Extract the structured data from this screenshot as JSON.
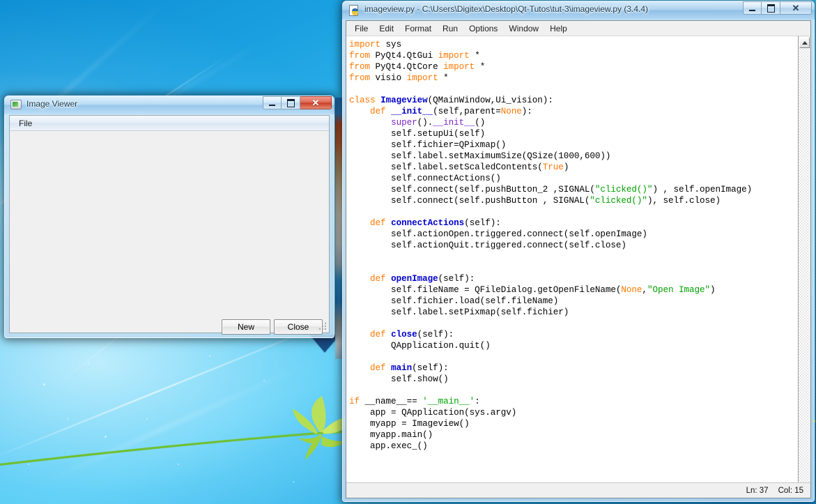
{
  "desktop": {
    "name": "windows-7-harmony-wallpaper"
  },
  "image_viewer": {
    "title": "Image Viewer",
    "icon": "app-monitor-icon",
    "menu": [
      "File"
    ],
    "buttons": {
      "new": "New",
      "close": "Close"
    },
    "window_controls": {
      "minimize": "minimize-icon",
      "maximize": "maximize-icon",
      "close": "✕"
    },
    "accent_close": "#cc3f28"
  },
  "idle": {
    "title": "imageview.py - C:\\Users\\Digitex\\Desktop\\Qt-Tutos\\tut-3\\imageview.py (3.4.4)",
    "icon": "python-file-icon",
    "menu": [
      "File",
      "Edit",
      "Format",
      "Run",
      "Options",
      "Window",
      "Help"
    ],
    "window_controls": {
      "minimize": "minimize-icon",
      "maximize": "maximize-icon",
      "close": "✕"
    },
    "status": {
      "line_label": "Ln: 37",
      "col_label": "Col: 15"
    },
    "colors": {
      "keyword": "#ff7700",
      "definition": "#0000cc",
      "builtin": "#7a27c4",
      "string": "#00a000",
      "text": "#000000",
      "background": "#ffffff"
    },
    "code_lines": [
      [
        [
          "k",
          "import"
        ],
        [
          "t",
          " sys"
        ]
      ],
      [
        [
          "k",
          "from"
        ],
        [
          "t",
          " PyQt4.QtGui "
        ],
        [
          "k",
          "import"
        ],
        [
          "t",
          " *"
        ]
      ],
      [
        [
          "k",
          "from"
        ],
        [
          "t",
          " PyQt4.QtCore "
        ],
        [
          "k",
          "import"
        ],
        [
          "t",
          " *"
        ]
      ],
      [
        [
          "k",
          "from"
        ],
        [
          "t",
          " visio "
        ],
        [
          "k",
          "import"
        ],
        [
          "t",
          " *"
        ]
      ],
      [],
      [
        [
          "k",
          "class"
        ],
        [
          "t",
          " "
        ],
        [
          "d",
          "Imageview"
        ],
        [
          "t",
          "(QMainWindow,Ui_vision):"
        ]
      ],
      [
        [
          "t",
          "    "
        ],
        [
          "k",
          "def"
        ],
        [
          "t",
          " "
        ],
        [
          "d",
          "__init__"
        ],
        [
          "t",
          "(self,parent="
        ],
        [
          "k",
          "None"
        ],
        [
          "t",
          "):"
        ]
      ],
      [
        [
          "t",
          "        "
        ],
        [
          "b",
          "super"
        ],
        [
          "t",
          "()."
        ],
        [
          "b",
          "__init__"
        ],
        [
          "t",
          "()"
        ]
      ],
      [
        [
          "t",
          "        self.setupUi(self)"
        ]
      ],
      [
        [
          "t",
          "        self.fichier=QPixmap()"
        ]
      ],
      [
        [
          "t",
          "        self.label.setMaximumSize(QSize(1000,600))"
        ]
      ],
      [
        [
          "t",
          "        self.label.setScaledContents("
        ],
        [
          "k",
          "True"
        ],
        [
          "t",
          ")"
        ]
      ],
      [
        [
          "t",
          "        self.connectActions()"
        ]
      ],
      [
        [
          "t",
          "        self.connect(self.pushButton_2 ,SIGNAL("
        ],
        [
          "s",
          "\"clicked()\""
        ],
        [
          "t",
          ") , self.openImage)"
        ]
      ],
      [
        [
          "t",
          "        self.connect(self.pushButton , SIGNAL("
        ],
        [
          "s",
          "\"clicked()\""
        ],
        [
          "t",
          "), self.close)"
        ]
      ],
      [],
      [
        [
          "t",
          "    "
        ],
        [
          "k",
          "def"
        ],
        [
          "t",
          " "
        ],
        [
          "d",
          "connectActions"
        ],
        [
          "t",
          "(self):"
        ]
      ],
      [
        [
          "t",
          "        self.actionOpen.triggered.connect(self.openImage)"
        ]
      ],
      [
        [
          "t",
          "        self.actionQuit.triggered.connect(self.close)"
        ]
      ],
      [],
      [],
      [
        [
          "t",
          "    "
        ],
        [
          "k",
          "def"
        ],
        [
          "t",
          " "
        ],
        [
          "d",
          "openImage"
        ],
        [
          "t",
          "(self):"
        ]
      ],
      [
        [
          "t",
          "        self.fileName = QFileDialog.getOpenFileName("
        ],
        [
          "k",
          "None"
        ],
        [
          "t",
          ","
        ],
        [
          "s",
          "\"Open Image\""
        ],
        [
          "t",
          ")"
        ]
      ],
      [
        [
          "t",
          "        self.fichier.load(self.fileName)"
        ]
      ],
      [
        [
          "t",
          "        self.label.setPixmap(self.fichier)"
        ]
      ],
      [],
      [
        [
          "t",
          "    "
        ],
        [
          "k",
          "def"
        ],
        [
          "t",
          " "
        ],
        [
          "d",
          "close"
        ],
        [
          "t",
          "(self):"
        ]
      ],
      [
        [
          "t",
          "        QApplication.quit()"
        ]
      ],
      [],
      [
        [
          "t",
          "    "
        ],
        [
          "k",
          "def"
        ],
        [
          "t",
          " "
        ],
        [
          "d",
          "main"
        ],
        [
          "t",
          "(self):"
        ]
      ],
      [
        [
          "t",
          "        self.show()"
        ]
      ],
      [],
      [
        [
          "k",
          "if"
        ],
        [
          "t",
          " __name__== "
        ],
        [
          "s",
          "'__main__'"
        ],
        [
          "t",
          ":"
        ]
      ],
      [
        [
          "t",
          "    app = QApplication(sys.argv)"
        ]
      ],
      [
        [
          "t",
          "    myapp = Imageview()"
        ]
      ],
      [
        [
          "t",
          "    myapp.main()"
        ]
      ],
      [
        [
          "t",
          "    app.exec_()"
        ]
      ]
    ]
  }
}
